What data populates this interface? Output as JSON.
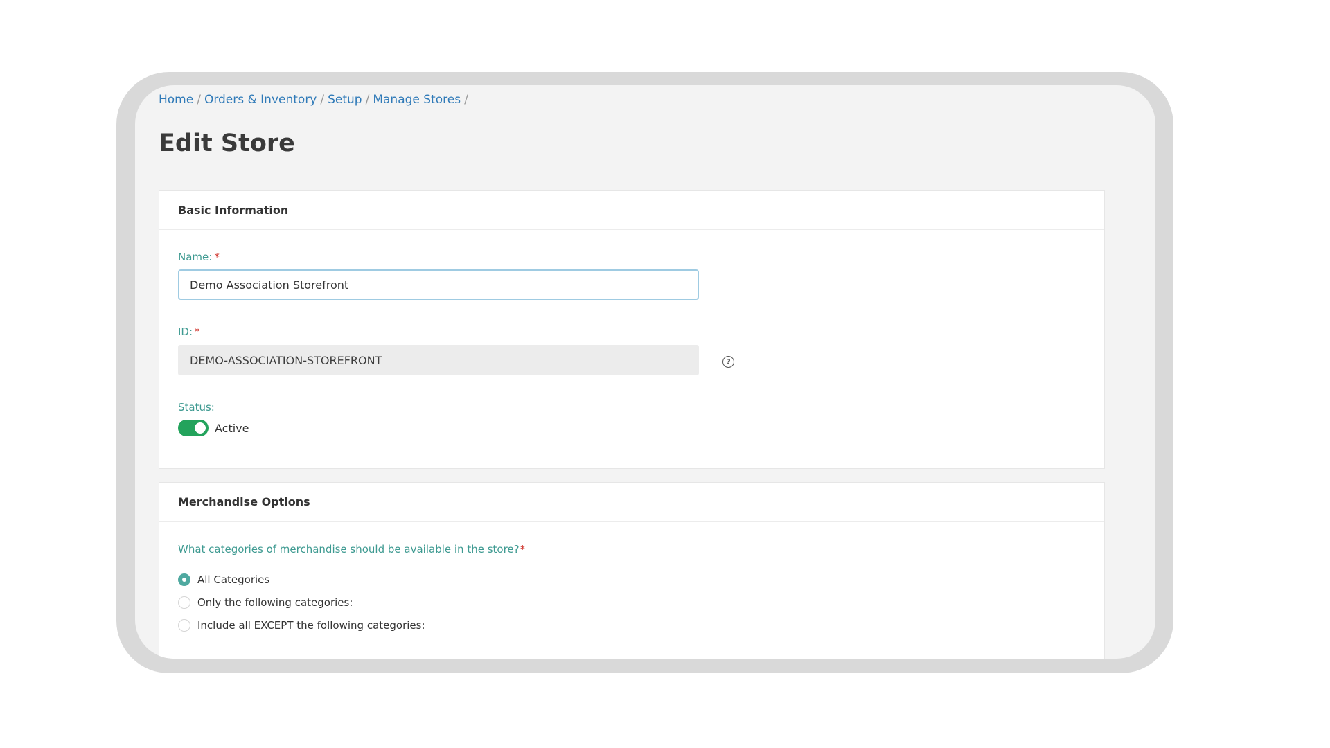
{
  "breadcrumb": {
    "items": [
      "Home",
      "Orders & Inventory",
      "Setup",
      "Manage Stores"
    ],
    "separator": "/"
  },
  "page": {
    "title": "Edit Store"
  },
  "basic_info": {
    "header": "Basic Information",
    "name_label": "Name:",
    "name_value": "Demo Association Storefront",
    "id_label": "ID:",
    "id_value": "DEMO-ASSOCIATION-STOREFRONT",
    "help_icon": "?",
    "status_label": "Status:",
    "status_value": "Active",
    "status_on": true,
    "required_mark": "*"
  },
  "merchandise": {
    "header": "Merchandise Options",
    "question": "What categories of merchandise should be available in the store?",
    "required_mark": "*",
    "options": [
      {
        "label": "All Categories",
        "selected": true
      },
      {
        "label": "Only the following categories:",
        "selected": false
      },
      {
        "label": "Include all EXCEPT the following categories:",
        "selected": false
      }
    ]
  },
  "colors": {
    "link": "#2f7ab8",
    "label": "#3e9a91",
    "toggle_on": "#23a35c",
    "radio_checked": "#4fa9a0",
    "required": "#d0342c"
  },
  "icons": {
    "help": "help-circle-icon"
  }
}
